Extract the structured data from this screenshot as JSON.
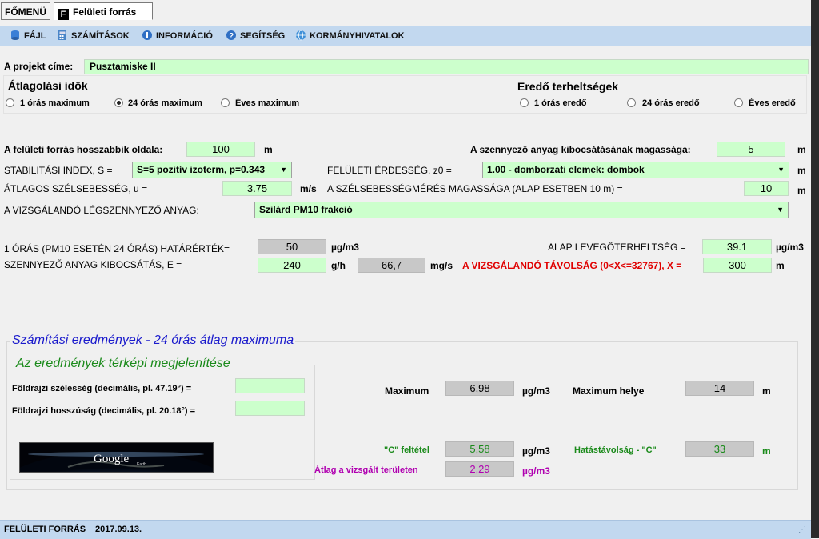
{
  "tabs": {
    "main": "FŐMENÜ",
    "surface": "Felületi forrás"
  },
  "menu": [
    {
      "label": "FÁJL",
      "icon": "database-icon"
    },
    {
      "label": "SZÁMÍTÁSOK",
      "icon": "calculator-icon"
    },
    {
      "label": "INFORMÁCIÓ",
      "icon": "info-icon"
    },
    {
      "label": "SEGÍTSÉG",
      "icon": "help-icon"
    },
    {
      "label": "KORMÁNYHIVATALOK",
      "icon": "globe-icon"
    }
  ],
  "project": {
    "label": "A projekt címe:",
    "value": "Pusztamiske II"
  },
  "averaging": {
    "title": "Átlagolási idők",
    "options": [
      "1 órás maximum",
      "24 órás maximum",
      "Éves maximum"
    ],
    "selected": "24 órás maximum"
  },
  "resultant": {
    "title": "Eredő terheltségek",
    "options": [
      "1 órás eredő",
      "24 órás eredő",
      "Éves eredő"
    ]
  },
  "params": {
    "longest_side_label": "A felületi forrás hosszabbik oldala:",
    "longest_side_value": "100",
    "longest_side_unit": "m",
    "emission_height_label": "A szennyező anyag kibocsátásának magassága:",
    "emission_height_value": "5",
    "emission_height_unit": "m",
    "stability_label": "STABILITÁSI INDEX, S =",
    "stability_value": "S=5 pozitív izoterm, p=0.343",
    "roughness_label": "FELÜLETI ÉRDESSÉG, z0 =",
    "roughness_value": "1.00 - domborzati elemek: dombok",
    "roughness_unit": "m",
    "wind_label": "ÁTLAGOS SZÉLSEBESSÉG, u =",
    "wind_value": "3.75",
    "wind_unit": "m/s",
    "wind_height_label": "A SZÉLSEBESSÉGMÉRÉS MAGASSÁGA (ALAP ESETBEN 10 m) =",
    "wind_height_value": "10",
    "wind_height_unit": "m",
    "pollutant_label": "A VIZSGÁLANDÓ LÉGSZENNYEZŐ ANYAG:",
    "pollutant_value": "Szilárd PM10 frakció",
    "limit_label": "1 ÓRÁS  (PM10 ESETÉN 24 ÓRÁS) HATÁRÉRTÉK=",
    "limit_value": "50",
    "limit_unit": "µg/m3",
    "background_label": "ALAP LEVEGŐTERHELTSÉG =",
    "background_value": "39.1",
    "background_unit": "µg/m3",
    "emission_label": "SZENNYEZŐ ANYAG KIBOCSÁTÁS, E =",
    "emission_gh": "240",
    "emission_gh_unit": "g/h",
    "emission_mgs": "66,7",
    "emission_mgs_unit": "mg/s",
    "distance_label": "A VIZSGÁLANDÓ TÁVOLSÁG (0<X<=32767), X =",
    "distance_value": "300",
    "distance_unit": "m"
  },
  "results": {
    "title": "Számítási eredmények - 24 órás átlag maximuma",
    "map_title": "Az eredmények térképi megjelenítése",
    "lat_label": "Földrajzi szélesség (decimális, pl. 47.19°) =",
    "lat_value": "",
    "lon_label": "Földrajzi hosszúság (decimális, pl. 20.18°) =",
    "lon_value": "",
    "google_label": "Google",
    "google_sub": "Earth",
    "maximum_label": "Maximum",
    "maximum_value": "6,98",
    "maximum_unit": "µg/m3",
    "max_place_label": "Maximum helye",
    "max_place_value": "14",
    "max_place_unit": "m",
    "c_label": "\"C\" feltétel",
    "c_value": "5,58",
    "c_unit": "µg/m3",
    "c_dist_label": "Hatástávolság - \"C\"",
    "c_dist_value": "33",
    "c_dist_unit": "m",
    "avg_label": "Átlag a vizsgált területen",
    "avg_value": "2,29",
    "avg_unit": "µg/m3"
  },
  "status": {
    "left": "FELÜLETI FORRÁS",
    "date": "2017.09.13."
  },
  "colors": {
    "field_green": "#ccffcc",
    "menu_blue": "#c2d8ef",
    "result_title": "#1a1acc",
    "map_title": "#1a8a1a",
    "warning_red": "#e00000",
    "avg_purple": "#b000b0"
  }
}
